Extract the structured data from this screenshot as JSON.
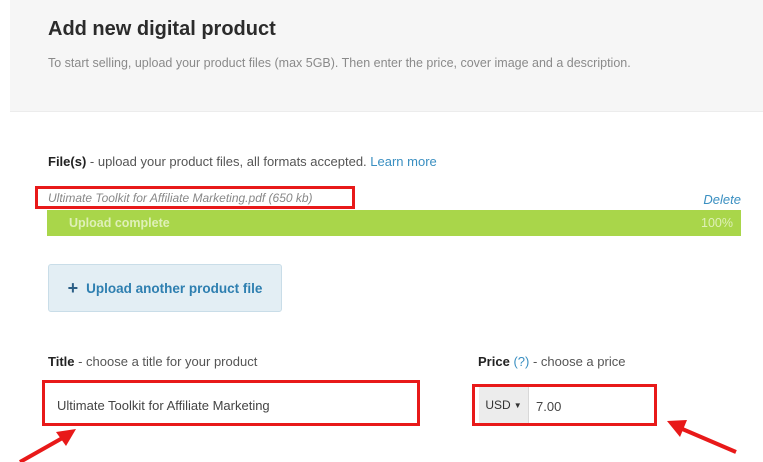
{
  "header": {
    "title": "Add new digital product",
    "subtitle": "To start selling, upload your product files (max 5GB). Then enter the price, cover image and a description."
  },
  "files": {
    "label_bold": "File(s)",
    "label_text": " - upload your product files, all formats accepted. ",
    "learn_more": "Learn more",
    "file_name": "Ultimate Toolkit for Affiliate Marketing.pdf (650 kb)",
    "delete_label": "Delete",
    "progress_label": "Upload complete",
    "progress_text": "100%",
    "progress_fraction": 1.0,
    "upload_another_label": "Upload another product file"
  },
  "title_field": {
    "label_bold": "Title",
    "label_text": " - choose a title for your product",
    "value": "Ultimate Toolkit for Affiliate Marketing"
  },
  "price_field": {
    "label_bold": "Price",
    "help": "(?)",
    "label_text": " - choose a price",
    "currency": "USD",
    "value": "7.00"
  },
  "colors": {
    "highlight_red": "#e81919",
    "progress_green": "#a9d64a",
    "link_blue": "#3a8fc1"
  },
  "icons": {
    "upload_button": "plus-icon",
    "currency_dropdown": "caret-down-icon"
  }
}
